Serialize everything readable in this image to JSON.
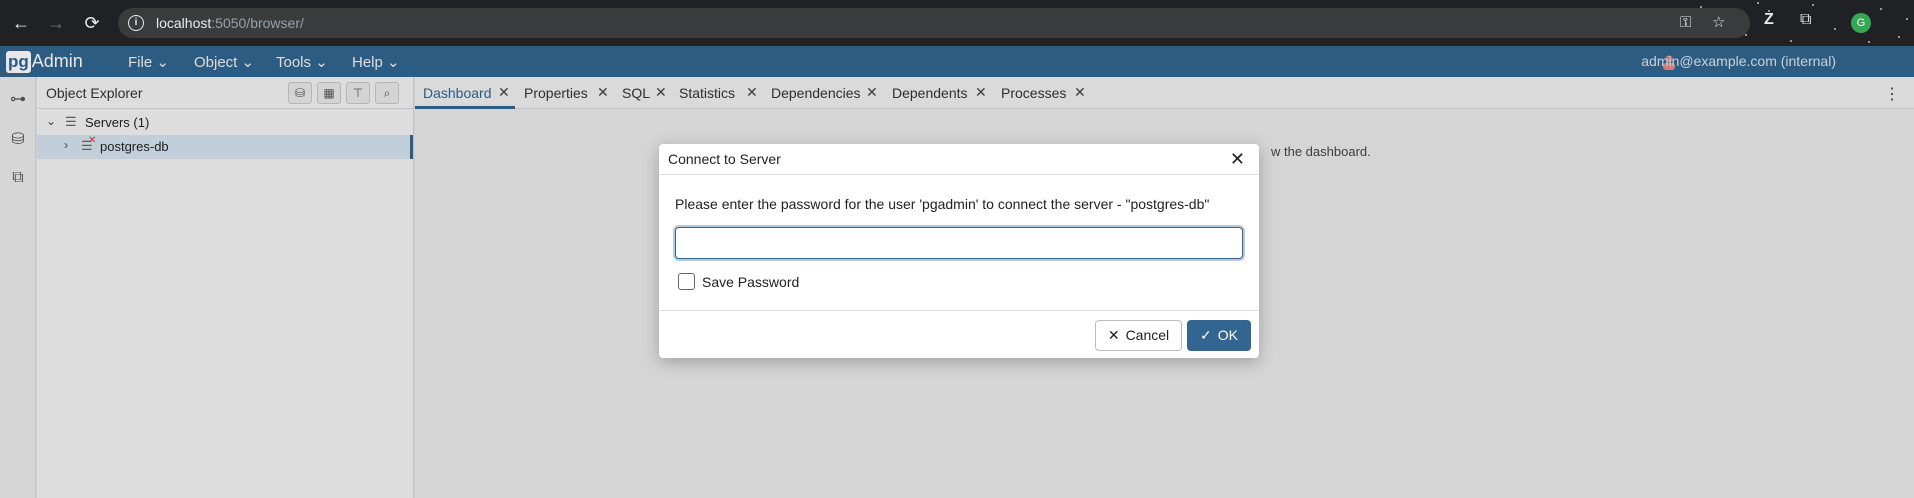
{
  "browser": {
    "url_host": "localhost",
    "url_rest": ":5050/browser/"
  },
  "app": {
    "logo_pg": "pg",
    "logo_admin": "Admin",
    "menus": [
      "File",
      "Object",
      "Tools",
      "Help"
    ],
    "user": "admin@example.com (internal)"
  },
  "object_explorer": {
    "title": "Object Explorer",
    "servers_label": "Servers (1)",
    "server_label": "postgres-db"
  },
  "tabs": [
    "Dashboard",
    "Properties",
    "SQL",
    "Statistics",
    "Dependencies",
    "Dependents",
    "Processes"
  ],
  "main": {
    "hint_fragment": "w the dashboard."
  },
  "dialog": {
    "title": "Connect to Server",
    "message": "Please enter the password for the user 'pgadmin' to connect the server - \"postgres-db\"",
    "password_value": "",
    "save_password_label": "Save Password",
    "save_password_checked": false,
    "cancel_label": "Cancel",
    "ok_label": "OK"
  },
  "colors": {
    "brand": "#326690",
    "chrome_bg": "#202124"
  }
}
